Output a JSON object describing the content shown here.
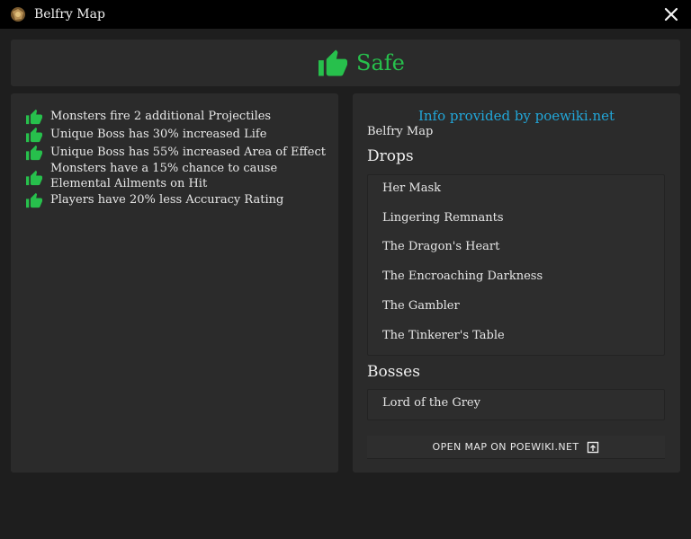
{
  "window": {
    "title": "Belfry Map",
    "close_icon": "close-icon",
    "app_icon": "map-icon"
  },
  "status": {
    "label": "Safe",
    "icon": "thumbs-up-icon",
    "color": "#27c04c"
  },
  "mods": [
    "Monsters fire 2 additional Projectiles",
    "Unique Boss has 30% increased Life",
    "Unique Boss has 55% increased Area of Effect",
    "Monsters have a 15% chance to cause Elemental Ailments on Hit",
    "Players have 20% less Accuracy Rating"
  ],
  "info": {
    "source": "Info provided by poewiki.net",
    "map_name": "Belfry Map",
    "drops_title": "Drops",
    "drops": [
      "Her Mask",
      "Lingering Remnants",
      "The Dragon's Heart",
      "The Encroaching Darkness",
      "The Gambler",
      "The Tinkerer's Table"
    ],
    "bosses_title": "Bosses",
    "bosses": [
      "Lord of the Grey"
    ],
    "open_button": "OPEN MAP ON POEWIKI.NET",
    "open_icon": "open-in-new-icon"
  },
  "colors": {
    "accent_green": "#27c04c",
    "link_blue": "#22a6d8",
    "panel": "#2b2b2b",
    "background": "#1e1e1e"
  }
}
